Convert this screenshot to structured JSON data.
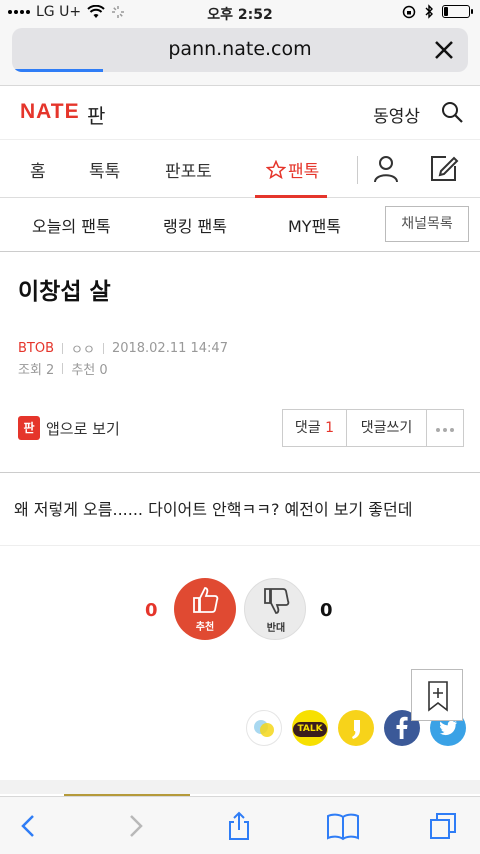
{
  "status_bar": {
    "carrier": "LG U+",
    "time": "오후 2:52",
    "battery_level": 0.2
  },
  "browser": {
    "url": "pann.nate.com",
    "load_progress": 0.2
  },
  "header": {
    "logo": "NATE",
    "logo_sub": "판",
    "video_link": "동영상"
  },
  "main_nav": {
    "items": [
      "홈",
      "톡톡",
      "판포토",
      "팬톡"
    ],
    "active_icon": "star-outline-icon"
  },
  "sub_nav": {
    "items": [
      "오늘의 팬톡",
      "랭킹 팬톡",
      "MY팬톡"
    ],
    "channel_button": "채널목록"
  },
  "article": {
    "title": "이창섭 살",
    "author": "BTOB",
    "nickname": "ㅇㅇ",
    "date": "2018.02.11 14:47",
    "views": "조회 2",
    "recommends": "추천 0",
    "body": "왜 저렇게 오름...... 다이어트 안핵ㅋㅋ? 예전이 보기 좋던데"
  },
  "actions": {
    "app_icon_text": "판",
    "app_view": "앱으로 보기",
    "comment_label": "댓글",
    "comment_count": "1",
    "write_comment": "댓글쓰기"
  },
  "votes": {
    "up_count": "0",
    "up_label": "추천",
    "down_count": "0",
    "down_label": "반대"
  },
  "share": {
    "kakaotalk": "TALK"
  },
  "colors": {
    "accent": "#e5352b",
    "browser_blue": "#2f7df6"
  }
}
